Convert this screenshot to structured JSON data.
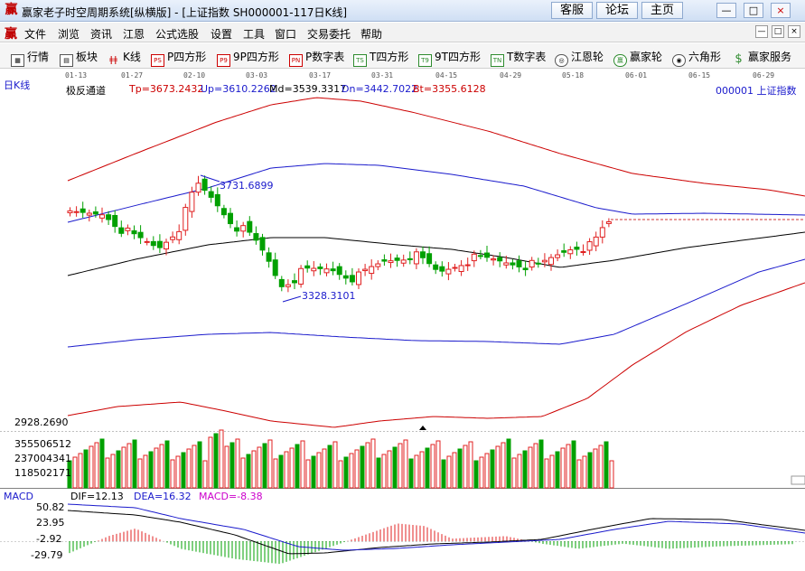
{
  "window": {
    "app_icon": "赢",
    "title": "赢家老子时空周期系统[纵横版] - [上证指数   SH000001-117日K线]",
    "buttons": [
      "客服",
      "论坛",
      "主页"
    ],
    "controls": [
      "—",
      "□",
      "×"
    ]
  },
  "menu": {
    "logo": "赢",
    "items": [
      "文件",
      "浏览",
      "资讯",
      "江恩",
      "公式选股",
      "设置",
      "工具",
      "窗口",
      "交易委托",
      "帮助"
    ],
    "mdi_controls": [
      "—",
      "□",
      "×"
    ]
  },
  "toolbar": {
    "items": [
      {
        "label": "行情",
        "icon": "grid-icon",
        "glyph": "▦"
      },
      {
        "label": "板块",
        "icon": "blocks-icon",
        "glyph": "▤"
      },
      {
        "label": "K线",
        "icon": "candlestick-icon",
        "glyph": "ǂǂ"
      },
      {
        "label": "P四方形",
        "icon": "ps-icon",
        "glyph": "PS"
      },
      {
        "label": "9P四方形",
        "icon": "p9-icon",
        "glyph": "P9"
      },
      {
        "label": "P数字表",
        "icon": "pn-icon",
        "glyph": "PN"
      },
      {
        "label": "T四方形",
        "icon": "ts-icon",
        "glyph": "TS"
      },
      {
        "label": "9T四方形",
        "icon": "t9-icon",
        "glyph": "T9"
      },
      {
        "label": "T数字表",
        "icon": "tn-icon",
        "glyph": "TN"
      },
      {
        "label": "江恩轮",
        "icon": "gann-wheel-icon",
        "glyph": "◎"
      },
      {
        "label": "赢家轮",
        "icon": "winner-wheel-icon",
        "glyph": "赢"
      },
      {
        "label": "六角形",
        "icon": "hexagon-icon",
        "glyph": "◉"
      },
      {
        "label": "赢家服务",
        "icon": "dollar-icon",
        "glyph": "$"
      }
    ]
  },
  "date_axis": [
    "01-13",
    "01-27",
    "02-10",
    "03-03",
    "03-17",
    "03-31",
    "04-15",
    "04-29",
    "05-18",
    "06-01",
    "06-15",
    "06-29"
  ],
  "main_panel": {
    "period_label": "日K线",
    "indicator_name": "极反通道",
    "params": [
      {
        "text": "Tp=3673.2432",
        "color": "#cc0000"
      },
      {
        "text": "Up=3610.2262",
        "color": "#1a1acc"
      },
      {
        "text": "Md=3539.3317",
        "color": "#000000"
      },
      {
        "text": "Dn=3442.7022",
        "color": "#1a1acc"
      },
      {
        "text": "Bt=3355.6128",
        "color": "#cc0000"
      }
    ],
    "symbol": "000001  上证指数",
    "high_annotation": "3731.6899",
    "low_annotation": "3328.3101",
    "bottom_value": "2928.2690"
  },
  "volume_panel": {
    "labels": [
      "355506512",
      "237004341",
      "118502171"
    ]
  },
  "macd_panel": {
    "name": "MACD",
    "dif": "DIF=12.13",
    "dea": "DEA=16.32",
    "macd": "MACD=-8.38",
    "axis_labels": [
      "50.82",
      "23.95",
      "-2.92",
      "-29.79"
    ]
  },
  "colors": {
    "up": "#e02020",
    "down": "#00a000",
    "channel_outer": "#cc0000",
    "channel_inner": "#1a1acc",
    "channel_mid": "#000000"
  }
}
